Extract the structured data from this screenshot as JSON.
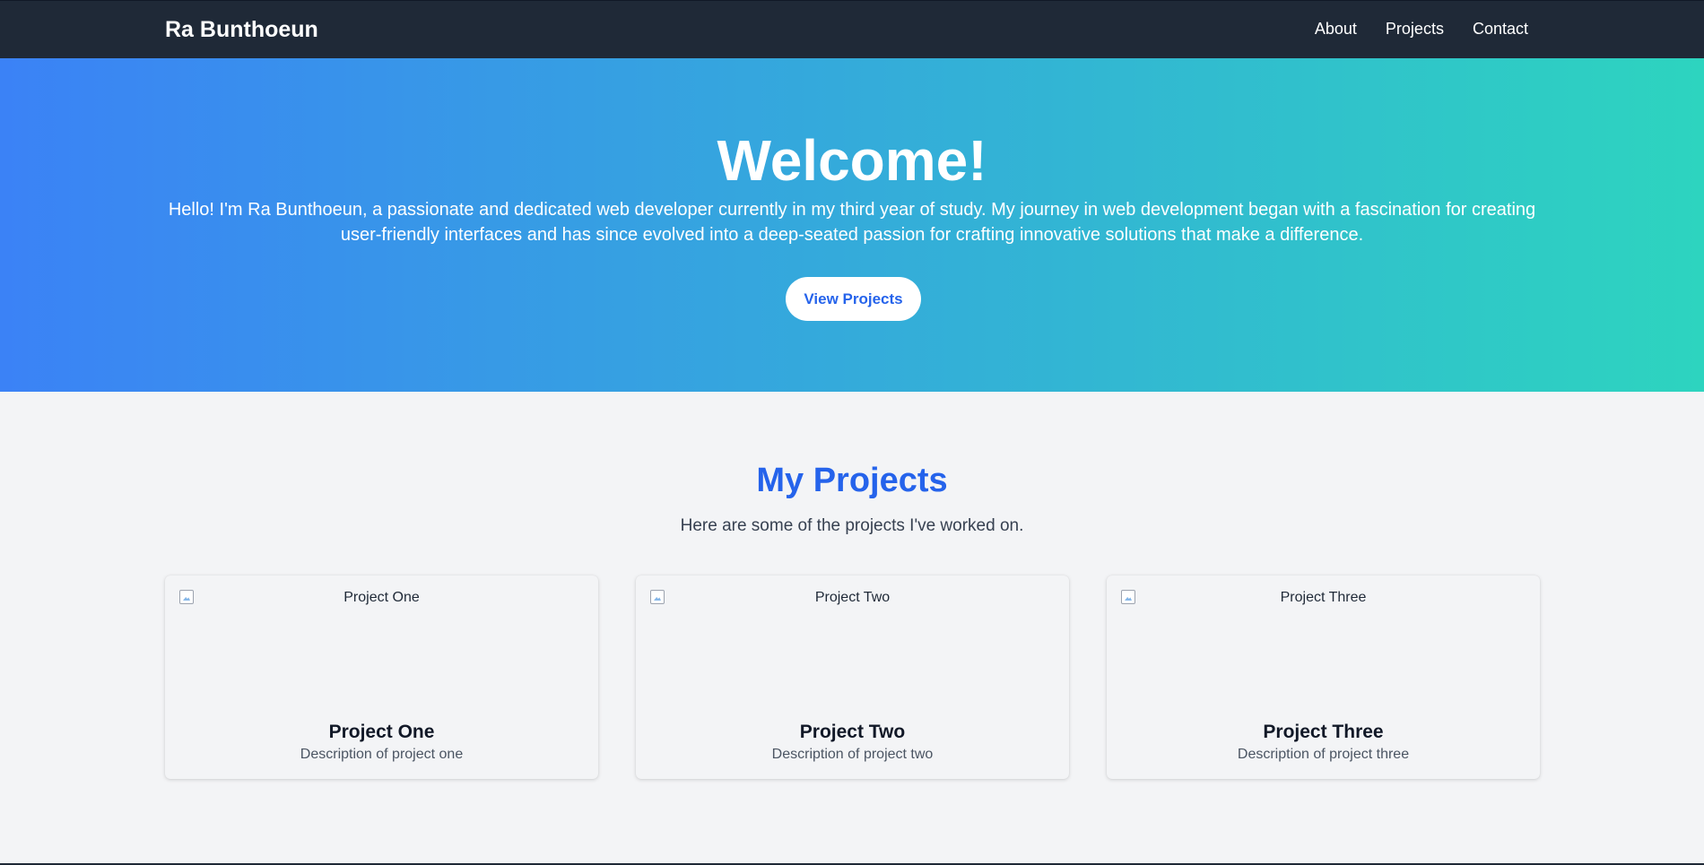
{
  "navbar": {
    "brand": "Ra Bunthoeun",
    "links": [
      "About",
      "Projects",
      "Contact"
    ]
  },
  "hero": {
    "title": "Welcome!",
    "intro": "Hello! I'm Ra Bunthoeun, a passionate and dedicated web developer currently in my third year of study. My journey in web development began with a fascination for creating user-friendly interfaces and has since evolved into a deep-seated passion for crafting innovative solutions that make a difference.",
    "button_label": "View Projects",
    "gradient_start": "#3b82f6",
    "gradient_end": "#2dd4bf"
  },
  "projects": {
    "title": "My Projects",
    "subtitle": "Here are some of the projects I've worked on.",
    "cards": [
      {
        "image_alt": "Project One",
        "title": "Project One",
        "description": "Description of project one"
      },
      {
        "image_alt": "Project Two",
        "title": "Project Two",
        "description": "Description of project two"
      },
      {
        "image_alt": "Project Three",
        "title": "Project Three",
        "description": "Description of project three"
      }
    ]
  },
  "colors": {
    "navbar_bg": "#1f2937",
    "accent": "#2563eb",
    "page_bg": "#f3f4f6"
  }
}
